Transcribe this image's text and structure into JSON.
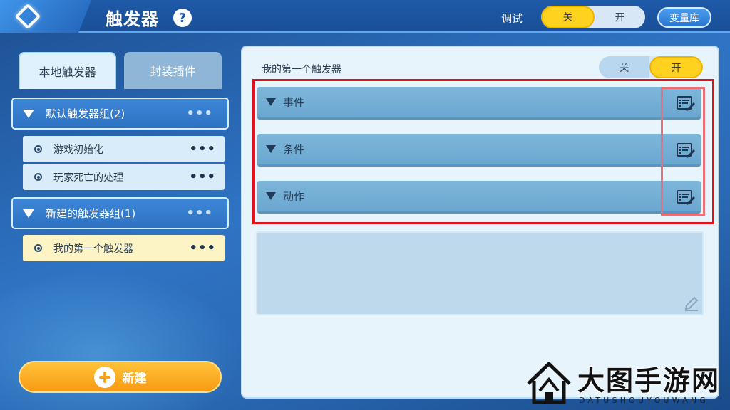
{
  "header": {
    "title": "触发器",
    "help_icon": "?",
    "debug_label": "调试",
    "debug_toggle": {
      "off": "关",
      "on": "开",
      "selected": "off"
    },
    "var_lib_label": "变量库"
  },
  "sidebar": {
    "tabs": [
      {
        "label": "本地触发器",
        "active": true
      },
      {
        "label": "封装插件",
        "active": false
      }
    ],
    "groups": [
      {
        "label": "默认触发器组(2)",
        "items": [
          {
            "label": "游戏初始化",
            "selected": false
          },
          {
            "label": "玩家死亡的处理",
            "selected": false
          }
        ]
      },
      {
        "label": "新建的触发器组(1)",
        "items": [
          {
            "label": "我的第一个触发器",
            "selected": true
          }
        ]
      }
    ],
    "more_icon": "•••",
    "new_button_label": "新建"
  },
  "main": {
    "trigger_name": "我的第一个触发器",
    "trigger_toggle": {
      "off": "关",
      "on": "开",
      "selected": "on"
    },
    "sections": [
      {
        "label": "事件"
      },
      {
        "label": "条件"
      },
      {
        "label": "动作"
      }
    ],
    "description_value": ""
  },
  "watermark": {
    "text": "大图手游网",
    "sub": "DATUSHOUYOUWANG"
  },
  "colors": {
    "accent_yellow": "#ffd21f",
    "highlight_red": "#e2121b",
    "header_blue": "#1e5aa8"
  }
}
